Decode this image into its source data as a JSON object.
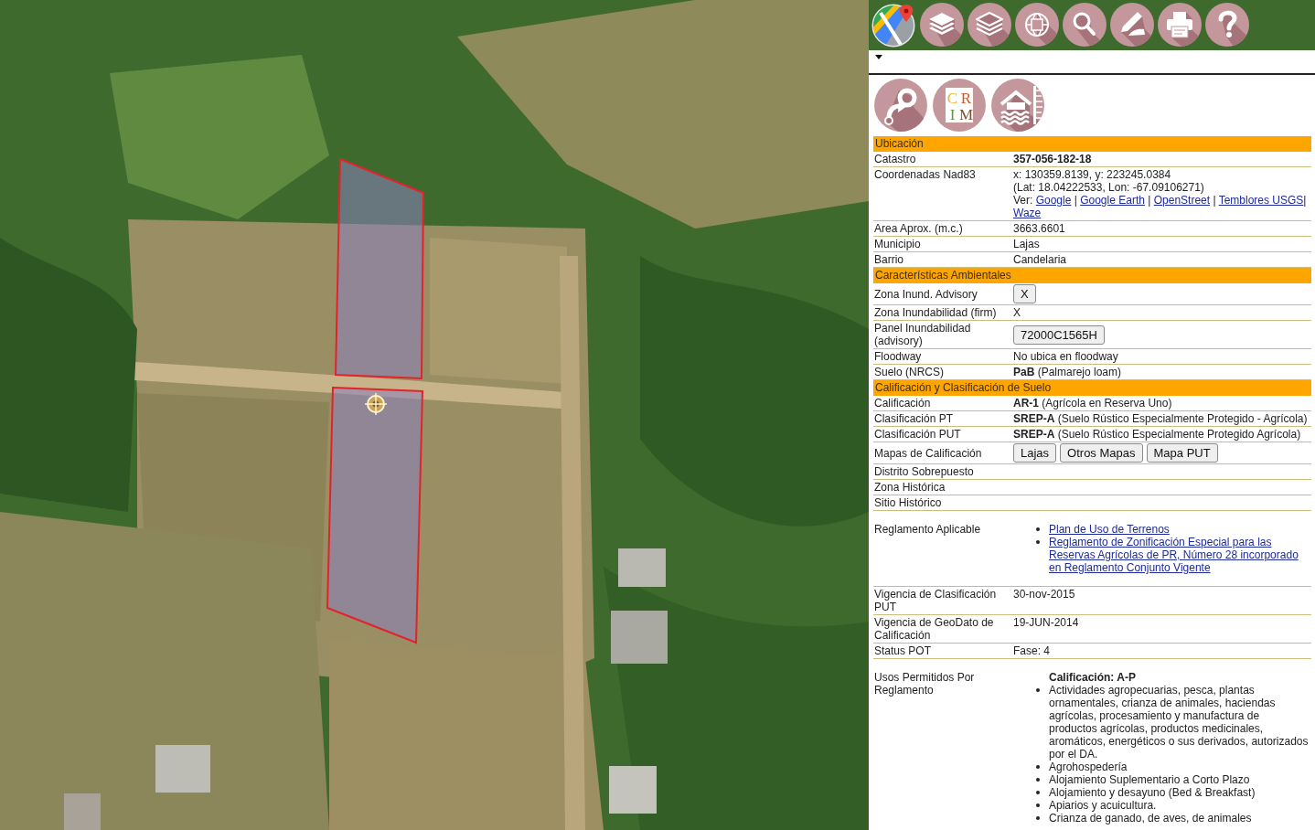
{
  "panel": {
    "expanded": true
  },
  "logo_letters": [
    "C",
    "R",
    "I",
    "M"
  ],
  "sections": [
    {
      "title": "Ubicación",
      "rows": [
        {
          "kind": "text",
          "label": "Catastro",
          "value": "357-056-182-18",
          "strong": true
        },
        {
          "kind": "coords",
          "label": "Coordenadas Nad83",
          "lines": [
            "x: 130359.8139, y: 223245.0384",
            "(Lat: 18.04222533, Lon: -67.09106271)"
          ],
          "links_line": [
            {
              "kind": "plain",
              "text": "Ver: "
            },
            {
              "kind": "link",
              "text": "Google"
            },
            {
              "kind": "plain",
              "text": " | "
            },
            {
              "kind": "link",
              "text": "Google Earth"
            },
            {
              "kind": "plain",
              "text": " | "
            },
            {
              "kind": "link",
              "text": "OpenStreet"
            },
            {
              "kind": "plain",
              "text": " | "
            },
            {
              "kind": "link",
              "text": "Temblores USGS"
            },
            {
              "kind": "plain",
              "text": "| "
            },
            {
              "kind": "link",
              "text": "Waze"
            }
          ]
        },
        {
          "kind": "text",
          "label": "Area Aprox. (m.c.)",
          "value": "3663.6601",
          "strong": false
        },
        {
          "kind": "text",
          "label": "Municipio",
          "value": "Lajas",
          "strong": false
        },
        {
          "kind": "text",
          "label": "Barrio",
          "value": "Candelaria",
          "strong": false
        }
      ]
    },
    {
      "title": "Características Ambientales",
      "rows": [
        {
          "kind": "buttons",
          "label": "Zona Inund. Advisory",
          "buttons": [
            "X"
          ]
        },
        {
          "kind": "text",
          "label": "Zona Inundabilidad (firm)",
          "value": "X",
          "strong": false
        },
        {
          "kind": "buttons",
          "label": "Panel Inundabilidad (advisory)",
          "buttons": [
            "72000C1565H"
          ]
        },
        {
          "kind": "text",
          "label": "Floodway",
          "value": "No ubica en floodway",
          "strong": false
        },
        {
          "kind": "text",
          "label": "Suelo (NRCS)",
          "value": "**PaB** (Palmarejo loam)",
          "strong": false
        }
      ]
    },
    {
      "title": "Calificación y Clasificación de Suelo",
      "rows": [
        {
          "kind": "text",
          "label": "Calificación",
          "value": "**AR-1** (Agrícola en Reserva Uno)",
          "strong": false
        },
        {
          "kind": "text",
          "label": "Clasificación PT",
          "value": "**SREP-A** (Suelo Rústico Especialmente Protegido - Agrícola)",
          "strong": false
        },
        {
          "kind": "text",
          "label": "Clasificación PUT",
          "value": "**SREP-A** (Suelo Rústico Especialmente Protegido Agrícola)",
          "strong": false
        },
        {
          "kind": "buttons",
          "label": "Mapas de Calificación",
          "buttons": [
            "Lajas",
            "Otros Mapas",
            "Mapa PUT"
          ]
        },
        {
          "kind": "empty",
          "label": "Distrito Sobrepuesto"
        },
        {
          "kind": "empty",
          "label": "Zona Histórica"
        },
        {
          "kind": "empty",
          "label": "Sitio Histórico"
        },
        {
          "kind": "links",
          "label": "Reglamento Aplicable",
          "links": [
            "Plan de Uso de Terrenos",
            "Reglamento de Zonificación Especial para las Reservas Agrícolas de PR, Número 28 incorporado en Reglamento Conjunto Vigente"
          ]
        },
        {
          "kind": "text",
          "label": "Vigencia de Clasificación PUT",
          "value": "30-nov-2015",
          "strong": false
        },
        {
          "kind": "text",
          "label": "Vigencia de GeoDato de Calificación",
          "value": "19-JUN-2014",
          "strong": false
        },
        {
          "kind": "text",
          "label": "Status POT",
          "value": "Fase: 4",
          "strong": false
        },
        {
          "kind": "uses",
          "label": "Usos Permitidos Por Reglamento",
          "heading": "Calificación: A-P",
          "items": [
            "Actividades agropecuarias, pesca, plantas ornamentales, crianza de animales, haciendas agrícolas, procesamiento y manufactura de productos agrícolas, productos medicinales, aromáticos, energéticos o sus derivados, autorizados por el DA.",
            "Agrohospedería",
            "Alojamiento Suplementario a Corto Plazo",
            "Alojamiento y desayuno (Bed & Breakfast)",
            "Apiarios y acuicultura.",
            "Crianza de ganado, de aves, de animales"
          ]
        }
      ]
    }
  ]
}
